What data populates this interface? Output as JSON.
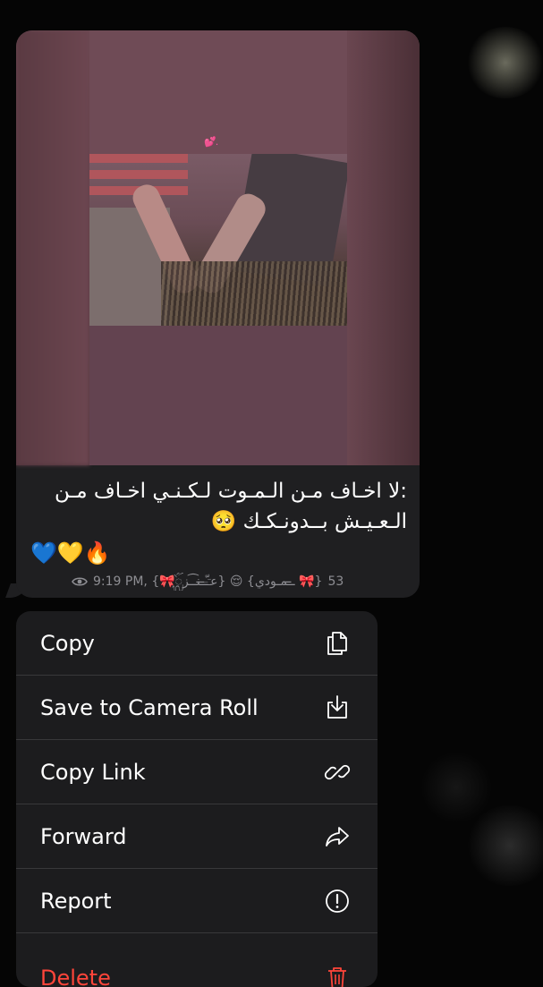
{
  "message": {
    "sticker_text": "💕.",
    "caption": ":لا اخـاف مـن الـمـوت لـكـنـي اخـاف مـن الـعـيـش بــدونـكـك 🥺",
    "reactions": "💙💛🔥",
    "meta": {
      "views": "53",
      "author": "{🎀عـ̶ؔـ̶ّـنـ͡ـزᬼ} 😌 {ـ̶̶ـمـودي 🎀}",
      "time": "9:19 PM"
    }
  },
  "menu": {
    "items": [
      {
        "label": "Copy",
        "icon": "copy-icon"
      },
      {
        "label": "Save to Camera Roll",
        "icon": "save-download-icon"
      },
      {
        "label": "Copy Link",
        "icon": "link-icon"
      },
      {
        "label": "Forward",
        "icon": "forward-arrow-icon"
      },
      {
        "label": "Report",
        "icon": "report-exclamation-icon"
      },
      {
        "label": "Delete",
        "icon": "trash-icon"
      }
    ]
  },
  "colors": {
    "background": "#050505",
    "bubble": "#1f1f21",
    "menu": "#1c1c1e",
    "separator": "#38383a",
    "meta_text": "#8e8e93",
    "danger": "#ff453a"
  }
}
